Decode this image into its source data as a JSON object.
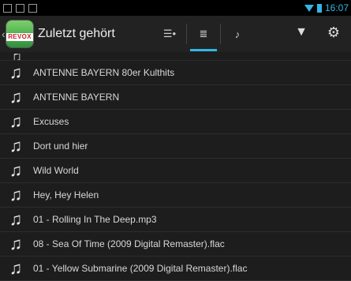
{
  "statusbar": {
    "time": "16:07"
  },
  "actionbar": {
    "logo_text": "REVOX",
    "title": "Zuletzt gehört",
    "tabs": [
      {
        "icon": "queue-play-icon",
        "glyph": "☰•"
      },
      {
        "icon": "list-icon",
        "glyph": "≣"
      },
      {
        "icon": "music-note-icon",
        "glyph": "♪"
      }
    ],
    "filter_icon": "filter-icon",
    "settings_icon": "gear-icon"
  },
  "list": {
    "items": [
      "ANTENNE BAYERN 80er Kulthits",
      "ANTENNE BAYERN",
      "Excuses",
      "Dort und hier",
      "Wild World",
      "Hey, Hey Helen",
      "01 - Rolling In The Deep.mp3",
      "08 - Sea Of Time (2009 Digital Remaster).flac",
      "01 - Yellow Submarine (2009 Digital Remaster).flac"
    ]
  }
}
